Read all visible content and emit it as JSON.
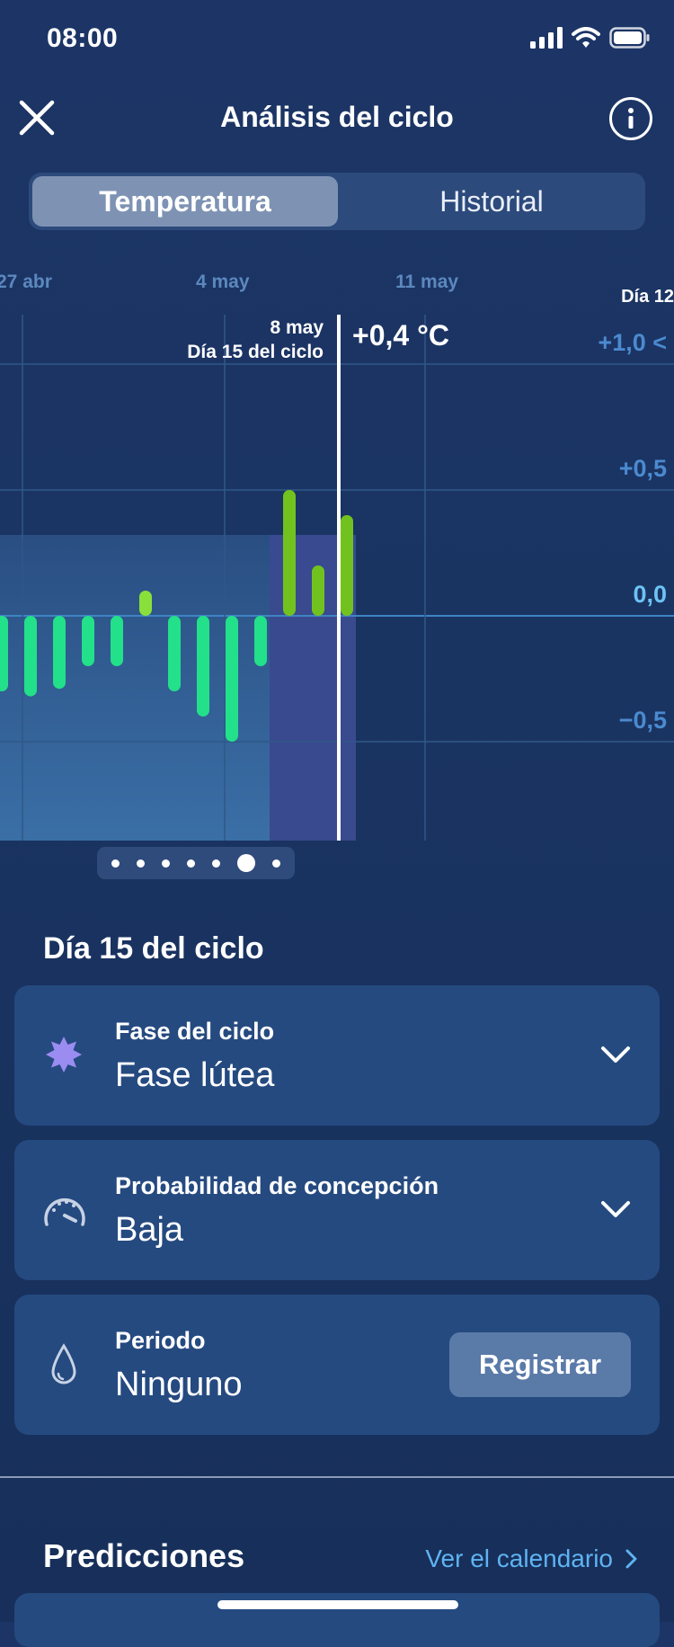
{
  "status_bar": {
    "time": "08:00"
  },
  "header": {
    "title": "Análisis del ciclo"
  },
  "tabs": {
    "active": "Temperatura",
    "inactive": "Historial"
  },
  "chart_data": {
    "type": "bar",
    "x_tick_labels": [
      "27 abr",
      "4 may",
      "11 may"
    ],
    "y_tick_labels": [
      "+1,0 <",
      "+0,5",
      "0,0",
      "−0,5"
    ],
    "ylim": [
      -0.9,
      1.1
    ],
    "top_right_label": "Día 12",
    "selected": {
      "date": "8 may",
      "cycle_day": "Día 15 del ciclo",
      "value_label": "+0,4 °C"
    },
    "values": [
      -0.3,
      -0.32,
      -0.29,
      -0.2,
      -0.2,
      0.1,
      -0.3,
      -0.4,
      -0.5,
      -0.2,
      0.5,
      0.2,
      0.4
    ],
    "colors": {
      "negative": "#23e08a",
      "positive_low": "#8ae03a",
      "positive_high": "#72c21f"
    }
  },
  "pager": {
    "count": 7,
    "selected_index": 5
  },
  "day": {
    "title": "Día 15 del ciclo",
    "phase": {
      "label": "Fase del ciclo",
      "value": "Fase lútea",
      "icon": "sun-burst-icon"
    },
    "probability": {
      "label": "Probabilidad de concepción",
      "value": "Baja",
      "icon": "gauge-icon"
    },
    "period": {
      "label": "Periodo",
      "value": "Ninguno",
      "icon": "drop-icon",
      "button": "Registrar"
    }
  },
  "predictions": {
    "title": "Predicciones",
    "link": "Ver el calendario"
  }
}
